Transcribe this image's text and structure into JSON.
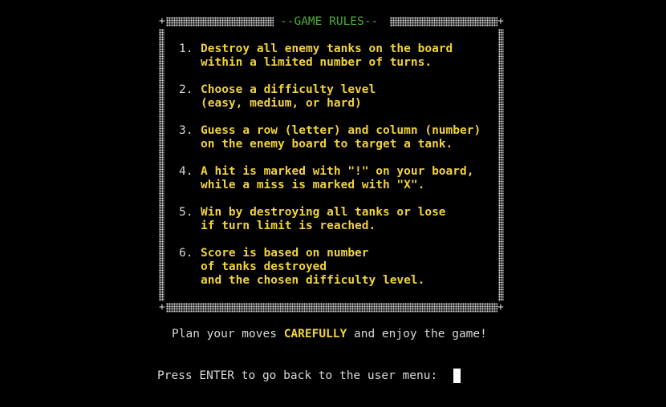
{
  "title": "--GAME RULES--",
  "corner_glyph": "+",
  "rules": [
    {
      "number": "1.",
      "lines": [
        "Destroy all enemy tanks on the board",
        "within a limited number of turns."
      ]
    },
    {
      "number": "2.",
      "lines": [
        "Choose a difficulty level",
        "(easy, medium, or hard)"
      ]
    },
    {
      "number": "3.",
      "lines": [
        "Guess a row (letter) and column (number)",
        "on the enemy board to target a tank."
      ]
    },
    {
      "number": "4.",
      "lines": [
        "A hit is marked with \"!\" on your board,",
        "while a miss is marked with \"X\"."
      ]
    },
    {
      "number": "5.",
      "lines": [
        "Win by destroying all tanks or lose",
        "if turn limit is reached."
      ]
    },
    {
      "number": "6.",
      "lines": [
        "Score is based on number",
        "of tanks destroyed",
        "and the chosen difficulty level."
      ]
    }
  ],
  "footer": {
    "before": "Plan your moves ",
    "emphasis": "CAREFULLY",
    "after": " and enjoy the game!"
  },
  "prompt": "Press ENTER to go back to the user menu: ",
  "colors": {
    "background": "#000000",
    "title": "#4caf2f",
    "rule_text": "#f0d23c",
    "default_text": "#d8d8d8",
    "cursor": "#ffffff"
  }
}
